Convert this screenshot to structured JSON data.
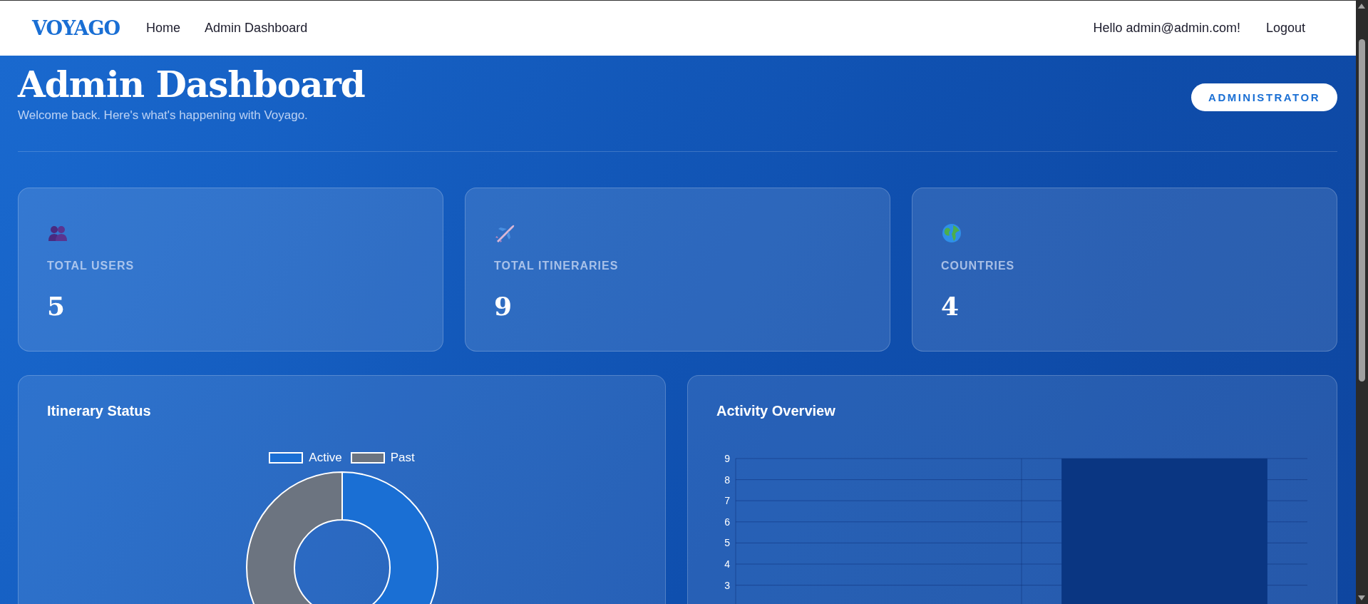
{
  "nav": {
    "logo": "VOYAGO",
    "links": [
      {
        "label": "Home"
      },
      {
        "label": "Admin Dashboard"
      }
    ],
    "greeting": "Hello admin@admin.com!",
    "logout": "Logout"
  },
  "header": {
    "title": "Admin Dashboard",
    "subtitle": "Welcome back. Here's what's happening with Voyago.",
    "role_badge": "ADMINISTRATOR"
  },
  "stats": [
    {
      "kind": "users",
      "label": "TOTAL USERS",
      "value": "5"
    },
    {
      "kind": "itineraries",
      "label": "TOTAL ITINERARIES",
      "value": "9"
    },
    {
      "kind": "countries",
      "label": "COUNTRIES",
      "value": "4"
    }
  ],
  "itinerary_status": {
    "title": "Itinerary Status",
    "legend": [
      {
        "label": "Active",
        "color": "#1a6fd4"
      },
      {
        "label": "Past",
        "color": "#6c7480"
      }
    ]
  },
  "activity_overview": {
    "title": "Activity Overview",
    "chart_data": {
      "type": "bar",
      "grid": true,
      "values": [
        null,
        9
      ],
      "ylim": [
        0,
        9
      ],
      "yticks": [
        3,
        4,
        5,
        6,
        7,
        8,
        9
      ]
    }
  }
}
